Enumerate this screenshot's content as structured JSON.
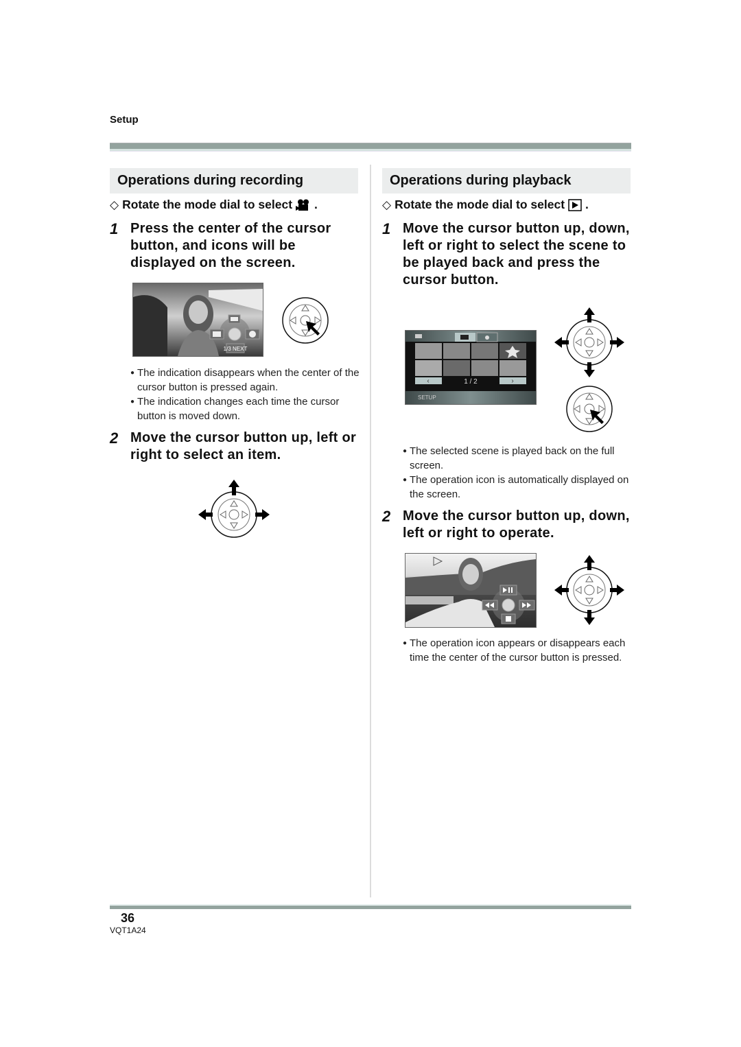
{
  "header": {
    "section": "Setup"
  },
  "recording": {
    "title": "Operations during recording",
    "prereq_symbol": "◇",
    "prereq": "Rotate the mode dial to select",
    "prereq_icon": "video-camera-icon",
    "prereq_end": ".",
    "step1": {
      "num": "1",
      "text": "Press the center of the cursor button, and icons will be displayed on the screen."
    },
    "screen1": {
      "menu_label": "1/3 NEXT",
      "icons": [
        "backlight-icon",
        "fade-icon",
        "info-icon",
        "center-button"
      ]
    },
    "bullets1": [
      "The indication disappears when the center of the cursor button is pressed again.",
      "The indication changes each time the cursor button is moved down."
    ],
    "step2": {
      "num": "2",
      "text": "Move the cursor button up, left or right to select an item."
    }
  },
  "playback": {
    "title": "Operations during playback",
    "prereq_symbol": "◇",
    "prereq": "Rotate the mode dial to select",
    "prereq_icon": "play-mode-icon",
    "prereq_end": ".",
    "step1": {
      "num": "1",
      "text": "Move the cursor button up, down, left or right to select the scene to be played back and press the cursor button."
    },
    "screen1": {
      "page": "1 / 2",
      "footer": "SETUP",
      "prev": "‹",
      "next": "›",
      "thumbnail_count": 8
    },
    "bullets1": [
      "The selected scene is played back on the full screen.",
      "The operation icon is automatically displayed on the screen."
    ],
    "step2": {
      "num": "2",
      "text": "Move the cursor button up, down, left or right to operate."
    },
    "screen2": {
      "icons": [
        "play-pause-icon",
        "rewind-icon",
        "fast-forward-icon",
        "stop-icon"
      ]
    },
    "bullets2": [
      "The operation icon appears or disappears each time the center of the cursor button is pressed."
    ]
  },
  "footer": {
    "page_number": "36",
    "doc_code": "VQT1A24"
  }
}
